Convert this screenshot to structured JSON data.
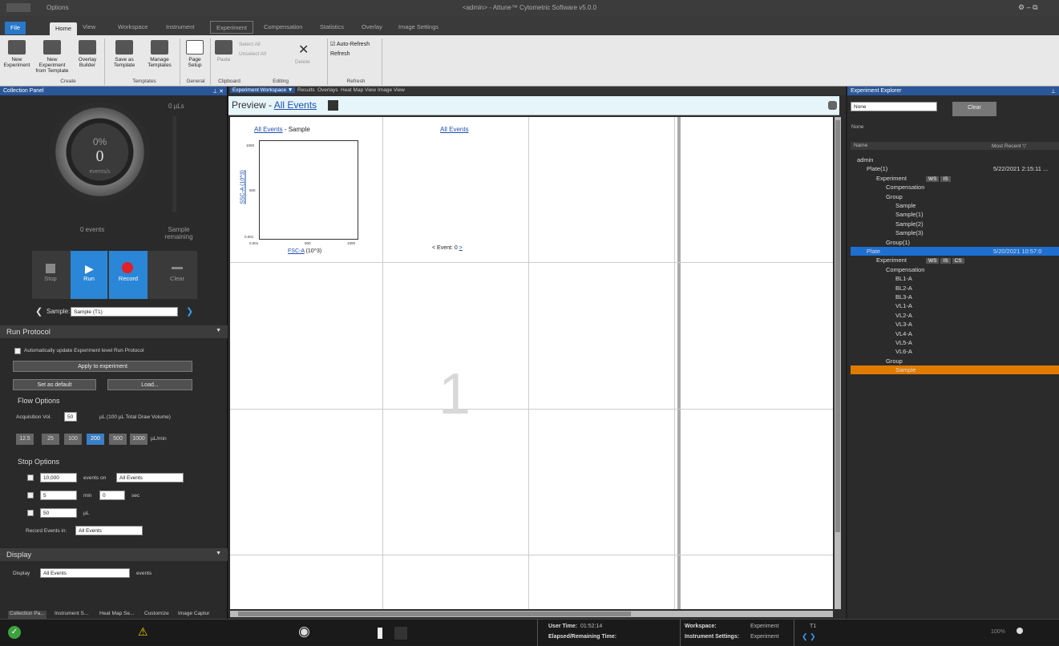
{
  "window": {
    "title": "<admin> - Attune™ Cytometric Software v5.0.0",
    "options": "Options"
  },
  "ribbon_tabs": [
    {
      "label": "File"
    },
    {
      "label": "Home"
    },
    {
      "label": "View"
    },
    {
      "label": "Workspace"
    },
    {
      "label": "Instrument"
    },
    {
      "label": "Experiment"
    },
    {
      "label": "Compensation"
    },
    {
      "label": "Statistics"
    },
    {
      "label": "Overlay"
    },
    {
      "label": "Image Settings"
    }
  ],
  "ribbon": {
    "buttons": [
      {
        "label": "New Experiment"
      },
      {
        "label": "New Experiment from Template"
      },
      {
        "label": "Overlay Builder"
      },
      {
        "label": "Save as Template"
      },
      {
        "label": "Manage Templates"
      },
      {
        "label": "Page Setup"
      }
    ],
    "clip": {
      "paste": "Paste",
      "select_all": "Select All",
      "unselect_all": "Unselect All",
      "delete": "Delete"
    },
    "auto_refresh": "Auto-Refresh",
    "refresh": "Refresh",
    "groups": [
      "Create",
      "Templates",
      "General",
      "Clipboard",
      "Editing",
      "Refresh"
    ]
  },
  "collection_panel": {
    "title": "Collection Panel",
    "volume": "0 µLs",
    "percent": "0%",
    "rate": "0",
    "rate_unit": "events/s",
    "events": "0 events",
    "sample_remaining": "Sample remaining",
    "controls": [
      "Stop",
      "Run",
      "Record",
      "Clear"
    ],
    "sample_label": "Sample:",
    "sample_value": "Sample (T1)"
  },
  "run_protocol": {
    "title": "Run Protocol",
    "auto_update": "Automatically update Experiment level Run Protocol",
    "apply": "Apply to experiment",
    "set_default": "Set as default",
    "load": "Load...",
    "flow_options": "Flow Options",
    "acq_label": "Acquisition Vol.",
    "acq_value": "50",
    "acq_note": "µL (100 µL Total Draw Volume)",
    "rates": [
      "12.5",
      "25",
      "100",
      "200",
      "500",
      "1000"
    ],
    "rate_unit": "µL/min",
    "stop_options": "Stop Options",
    "stop_events": "10,000",
    "events_on": "events on",
    "events_on_value": "All Events",
    "stop_min": "5",
    "min_label": "min",
    "stop_sec": "0",
    "sec_label": "sec",
    "stop_ul": "50",
    "ul_label": "µL",
    "record_in_label": "Record Events in:",
    "record_in_value": "All Events"
  },
  "display": {
    "title": "Display",
    "label": "Display",
    "value": "All Events",
    "suffix": "events"
  },
  "left_tabs": [
    "Collection Pa...",
    "Instrument S...",
    "Heat Map Se...",
    "Customize",
    "Image Captur"
  ],
  "center": {
    "tabs": [
      "Experiment Workspace ▼",
      "Results",
      "Overlays",
      "Heat Map View",
      "Image View"
    ],
    "preview": "Preview - ",
    "preview_link": "All Events",
    "plot_title_link": "All Events",
    "plot_title_rest": " - Sample",
    "ylabel": "SSC-A (10^3)",
    "xlabel_link": "FSC-A",
    "xlabel_rest": " (10^3)",
    "yticks": [
      "1000",
      "500",
      "0.001"
    ],
    "xticks": [
      "0.001",
      "500",
      "1000"
    ],
    "plot2_title": "All Events",
    "event_nav": "< Event: 0 ",
    "event_next": ">",
    "page_number": "1"
  },
  "explorer": {
    "title": "Experiment Explorer",
    "filter": "None",
    "clear": "Clear",
    "filter_label": "None",
    "col_name": "Name",
    "col_recent": "Most Recent",
    "nodes": [
      {
        "label": "admin",
        "level": 0
      },
      {
        "label": "Plate(1)",
        "level": 1,
        "date": "5/22/2021 2:15:11 ..."
      },
      {
        "label": "Experiment",
        "level": 2,
        "badges": [
          "WS",
          "IS"
        ]
      },
      {
        "label": "Compensation",
        "level": 3
      },
      {
        "label": "Group",
        "level": 3
      },
      {
        "label": "Sample",
        "level": 4
      },
      {
        "label": "Sample(1)",
        "level": 4
      },
      {
        "label": "Sample(2)",
        "level": 4
      },
      {
        "label": "Sample(3)",
        "level": 4
      },
      {
        "label": "Group(1)",
        "level": 3
      },
      {
        "label": "Plate",
        "level": 1,
        "date": "5/20/2021 10:57:0",
        "selected": true
      },
      {
        "label": "Experiment",
        "level": 2,
        "badges": [
          "WS",
          "IS",
          "CS"
        ]
      },
      {
        "label": "Compensation",
        "level": 3
      },
      {
        "label": "BL1-A",
        "level": 4
      },
      {
        "label": "BL2-A",
        "level": 4
      },
      {
        "label": "BL3-A",
        "level": 4
      },
      {
        "label": "VL1-A",
        "level": 4
      },
      {
        "label": "VL2-A",
        "level": 4
      },
      {
        "label": "VL3-A",
        "level": 4
      },
      {
        "label": "VL4-A",
        "level": 4
      },
      {
        "label": "VL5-A",
        "level": 4
      },
      {
        "label": "VL6-A",
        "level": 4
      },
      {
        "label": "Group",
        "level": 3
      },
      {
        "label": "Sample",
        "level": 4,
        "highlight": true
      }
    ]
  },
  "status": {
    "user_time_label": "User Time:",
    "user_time": "01:52:14",
    "elapsed_label": "Elapsed/Remaining Time:",
    "workspace_label": "Workspace:",
    "workspace_value": "Experiment",
    "inst_label": "Instrument Settings:",
    "inst_value": "Experiment",
    "tube": "T1",
    "zoom": "100%"
  },
  "colors": {
    "accent": "#2b579a",
    "highlight": "#e07b00",
    "select": "#1e6fd0"
  }
}
